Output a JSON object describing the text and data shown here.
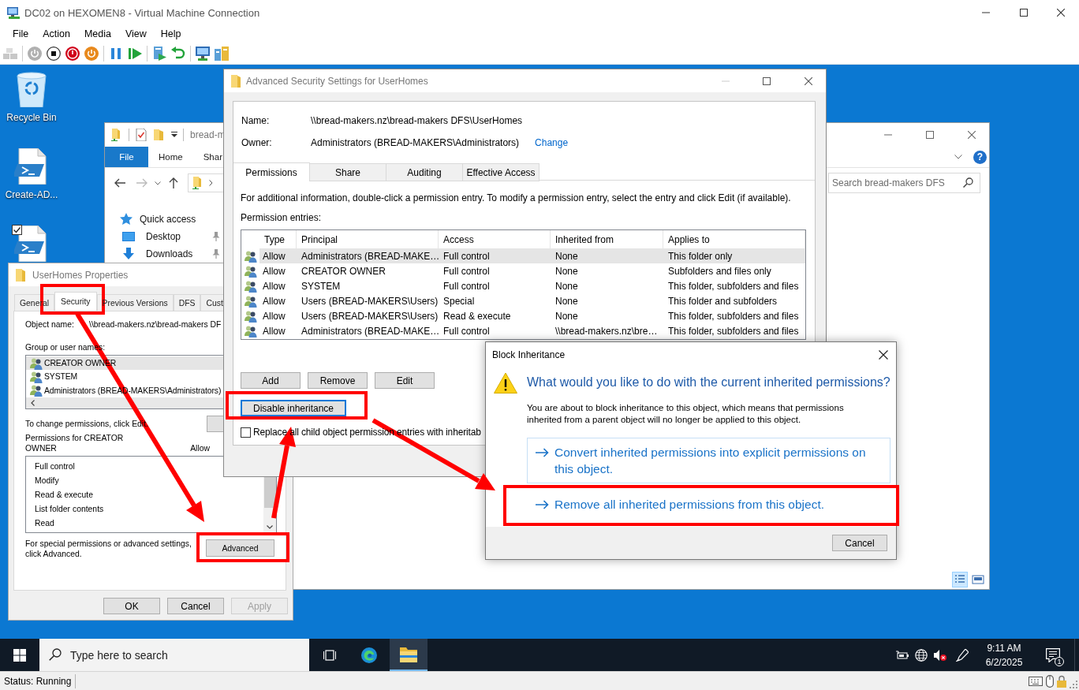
{
  "vm_window": {
    "title": "DC02 on HEXOMEN8 - Virtual Machine Connection",
    "menu": [
      "File",
      "Action",
      "Media",
      "View",
      "Help"
    ]
  },
  "desktop_icons": [
    {
      "label": "Recycle Bin",
      "kind": "recycle-bin",
      "checked": false
    },
    {
      "label": "Create-AD...",
      "kind": "script",
      "checked": false
    },
    {
      "kind": "script",
      "checked": true
    }
  ],
  "explorer": {
    "title": "bread-m",
    "ribbon_tabs": [
      {
        "label": "File",
        "kind": "file-menu"
      },
      {
        "label": "Home",
        "kind": "tab"
      },
      {
        "label": "Shar",
        "kind": "tab"
      }
    ],
    "help": "?",
    "search": {
      "placeholder": "Search bread-makers DFS"
    },
    "nav": [
      {
        "label": "Quick access",
        "kind": "quick-access",
        "pinned": false
      },
      {
        "label": "Desktop",
        "kind": "desktop",
        "pinned": true
      },
      {
        "label": "Downloads",
        "kind": "downloads",
        "pinned": true
      }
    ],
    "views": [
      {
        "kind": "details",
        "selected": true
      },
      {
        "kind": "large-icons",
        "selected": false
      }
    ]
  },
  "properties": {
    "title": "UserHomes Properties",
    "tabs": [
      {
        "label": "General",
        "selected": false,
        "highlighted": false
      },
      {
        "label": "Security",
        "selected": true,
        "highlighted": true
      },
      {
        "label": "Previous Versions",
        "selected": false,
        "highlighted": false
      },
      {
        "label": "DFS",
        "selected": false,
        "highlighted": false
      },
      {
        "label": "Cust",
        "selected": false,
        "highlighted": false
      }
    ],
    "object_name_label": "Object name:",
    "object_name": "\\\\bread-makers.nz\\bread-makers DF",
    "groups_label": "Group or user names:",
    "groups": [
      {
        "name": "CREATOR OWNER",
        "selected": true
      },
      {
        "name": "SYSTEM",
        "selected": false
      },
      {
        "name": "Administrators (BREAD-MAKERS\\Administrators)",
        "selected": false
      }
    ],
    "change_hint": "To change permissions, click Edit.",
    "permissions_label": "Permissions for CREATOR OWNER",
    "allow_header": "Allow",
    "permissions": [
      "Full control",
      "Modify",
      "Read & execute",
      "List folder contents",
      "Read"
    ],
    "advanced_hint": "For special permissions or advanced settings, click Advanced.",
    "advanced_button": {
      "label": "Advanced",
      "highlighted": true
    },
    "buttons": [
      {
        "label": "OK",
        "disabled": false
      },
      {
        "label": "Cancel",
        "disabled": false
      },
      {
        "label": "Apply",
        "disabled": true
      }
    ]
  },
  "advanced": {
    "title": "Advanced Security Settings for UserHomes",
    "name_label": "Name:",
    "name": "\\\\bread-makers.nz\\bread-makers DFS\\UserHomes",
    "owner_label": "Owner:",
    "owner": "Administrators (BREAD-MAKERS\\Administrators)",
    "change_link": "Change",
    "tabs": [
      {
        "label": "Permissions",
        "selected": true
      },
      {
        "label": "Share",
        "selected": false
      },
      {
        "label": "Auditing",
        "selected": false
      },
      {
        "label": "Effective Access",
        "selected": false
      }
    ],
    "info": "For additional information, double-click a permission entry. To modify a permission entry, select the entry and click Edit (if available).",
    "entries_label": "Permission entries:",
    "columns": [
      "Type",
      "Principal",
      "Access",
      "Inherited from",
      "Applies to"
    ],
    "rows": [
      {
        "selected": true,
        "cells": [
          "Allow",
          "Administrators (BREAD-MAKE…",
          "Full control",
          "None",
          "This folder only"
        ]
      },
      {
        "selected": false,
        "cells": [
          "Allow",
          "CREATOR OWNER",
          "Full control",
          "None",
          "Subfolders and files only"
        ]
      },
      {
        "selected": false,
        "cells": [
          "Allow",
          "SYSTEM",
          "Full control",
          "None",
          "This folder, subfolders and files"
        ]
      },
      {
        "selected": false,
        "cells": [
          "Allow",
          "Users (BREAD-MAKERS\\Users)",
          "Special",
          "None",
          "This folder and subfolders"
        ]
      },
      {
        "selected": false,
        "cells": [
          "Allow",
          "Users (BREAD-MAKERS\\Users)",
          "Read & execute",
          "None",
          "This folder, subfolders and files"
        ]
      },
      {
        "selected": false,
        "cells": [
          "Allow",
          "Administrators (BREAD-MAKE…",
          "Full control",
          "\\\\bread-makers.nz\\bre…",
          "This folder, subfolders and files"
        ]
      }
    ],
    "buttons": [
      "Add",
      "Remove",
      "Edit"
    ],
    "disable_button": {
      "label": "Disable inheritance",
      "focused": true,
      "highlighted": true
    },
    "replace_checkbox": {
      "label": "Replace all child object permission entries with inheritab",
      "checked": false
    }
  },
  "block_dialog": {
    "title": "Block Inheritance",
    "heading": "What would you like to do with the current inherited permissions?",
    "body": "You are about to block inheritance to this object, which means that permissions inherited from a parent object will no longer be applied to this object.",
    "options": [
      {
        "label": "Convert inherited permissions into explicit permissions on this object.",
        "hovered": true,
        "highlighted": false
      },
      {
        "label": "Remove all inherited permissions from this object.",
        "hovered": false,
        "highlighted": true
      }
    ],
    "cancel": "Cancel"
  },
  "taskbar": {
    "search": {
      "placeholder": "Type here to search"
    },
    "apps": [
      {
        "kind": "task-view",
        "active": false
      },
      {
        "kind": "edge",
        "active": false
      },
      {
        "kind": "explorer",
        "active": true
      }
    ],
    "time": "9:11 AM",
    "date": "6/2/2025",
    "notifications": "1"
  },
  "status_bar": {
    "text": "Status: Running"
  }
}
